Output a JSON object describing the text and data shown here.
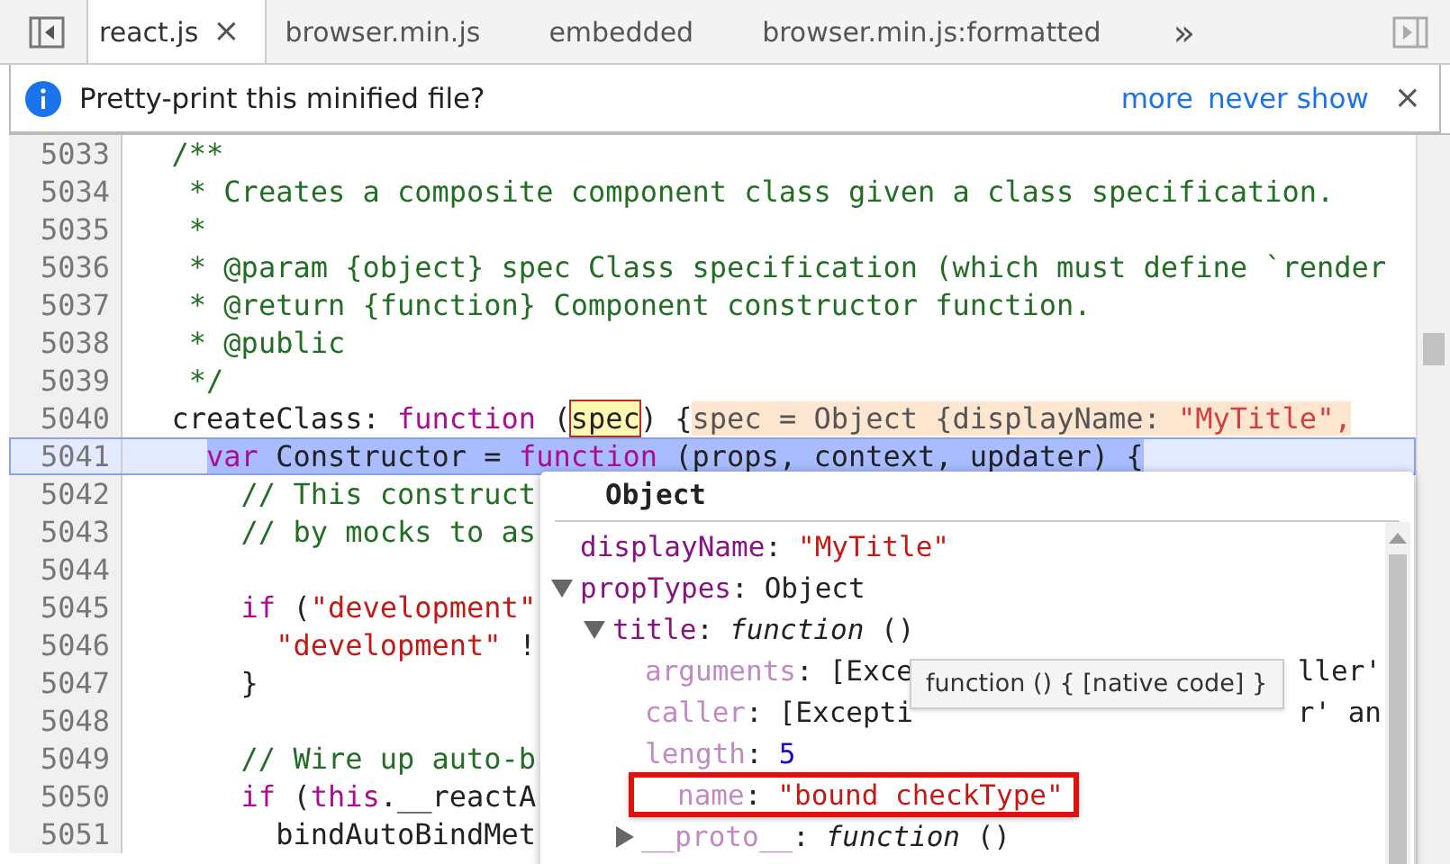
{
  "tabs": [
    {
      "label": "react.js",
      "selected": true,
      "close": "×"
    },
    {
      "label": "browser.min.js",
      "selected": false
    },
    {
      "label": "embedded",
      "selected": false
    },
    {
      "label": "browser.min.js:formatted",
      "selected": false
    }
  ],
  "more_tabs": "»",
  "infobar": {
    "message": "Pretty-print this minified file?",
    "links": [
      "more",
      "never show"
    ],
    "close": "×"
  },
  "lines": [
    {
      "number": "5033",
      "highlighted": false,
      "tokens": [
        {
          "kind": "comment",
          "text": "  /**"
        }
      ]
    },
    {
      "number": "5034",
      "highlighted": false,
      "tokens": [
        {
          "kind": "comment",
          "text": "   * Creates a composite component class given a class specification."
        }
      ]
    },
    {
      "number": "5035",
      "highlighted": false,
      "tokens": [
        {
          "kind": "comment",
          "text": "   *"
        }
      ]
    },
    {
      "number": "5036",
      "highlighted": false,
      "tokens": [
        {
          "kind": "comment",
          "text": "   * @param {object} spec Class specification (which must define `render"
        }
      ]
    },
    {
      "number": "5037",
      "highlighted": false,
      "tokens": [
        {
          "kind": "comment",
          "text": "   * @return {function} Component constructor function."
        }
      ]
    },
    {
      "number": "5038",
      "highlighted": false,
      "tokens": [
        {
          "kind": "comment",
          "text": "   * @public"
        }
      ]
    },
    {
      "number": "5039",
      "highlighted": false,
      "tokens": [
        {
          "kind": "comment",
          "text": "   */"
        }
      ]
    },
    {
      "number": "5040",
      "highlighted": false,
      "tokens": [
        {
          "kind": "plain",
          "text": "  createClass:"
        },
        {
          "kind": "keyword",
          "text": " function"
        },
        {
          "kind": "plain",
          "text": " ("
        },
        {
          "kind": "hovered",
          "text": "spec"
        },
        {
          "kind": "plain",
          "text": ") {"
        },
        {
          "kind": "hint",
          "text": "spec = Object {displayName: "
        },
        {
          "kind": "hint-string",
          "text": "\"MyTitle\","
        }
      ]
    },
    {
      "number": "5041",
      "highlighted": true,
      "tokens": [
        {
          "kind": "keyword",
          "text": "    var"
        },
        {
          "kind": "plain",
          "text": " Constructor = "
        },
        {
          "kind": "keyword",
          "text": "function"
        },
        {
          "kind": "plain",
          "text": " (props, context, updater) {"
        }
      ]
    },
    {
      "number": "5042",
      "highlighted": false,
      "tokens": [
        {
          "kind": "comment",
          "text": "      // This construct"
        }
      ]
    },
    {
      "number": "5043",
      "highlighted": false,
      "tokens": [
        {
          "kind": "comment",
          "text": "      // by mocks to as"
        }
      ]
    },
    {
      "number": "5044",
      "highlighted": false
    },
    {
      "number": "5045",
      "highlighted": false,
      "tokens": [
        {
          "kind": "keyword",
          "text": "      if"
        },
        {
          "kind": "plain",
          "text": " ("
        },
        {
          "kind": "string",
          "text": "\"development\""
        }
      ]
    },
    {
      "number": "5046",
      "highlighted": false,
      "tokens": [
        {
          "kind": "string",
          "text": "        \"development\""
        },
        {
          "kind": "plain",
          "text": " !"
        }
      ]
    },
    {
      "number": "5047",
      "highlighted": false,
      "tokens": [
        {
          "kind": "plain",
          "text": "      }"
        }
      ]
    },
    {
      "number": "5048",
      "highlighted": false
    },
    {
      "number": "5049",
      "highlighted": false,
      "tokens": [
        {
          "kind": "comment",
          "text": "      // Wire up auto-b"
        }
      ]
    },
    {
      "number": "5050",
      "highlighted": false,
      "tokens": [
        {
          "kind": "keyword",
          "text": "      if"
        },
        {
          "kind": "plain",
          "text": " ("
        },
        {
          "kind": "keyword",
          "text": "this"
        },
        {
          "kind": "plain",
          "text": ".__reactA"
        }
      ]
    },
    {
      "number": "5051",
      "highlighted": false,
      "tokens": [
        {
          "kind": "plain",
          "text": "        bindAutoBindMet"
        }
      ]
    }
  ],
  "popover": {
    "title": "Object",
    "tree": [
      {
        "key": "displayName",
        "colon": ":",
        "faded": false,
        "value": "\"MyTitle\"",
        "kind": "string"
      },
      {
        "key": "propTypes",
        "colon": ":",
        "faded": false,
        "value": "Object",
        "kind": "object",
        "expanded": true,
        "children": [
          {
            "key": "title",
            "colon": ":",
            "faded": false,
            "value": "*function* ()",
            "kind": "function",
            "expanded": true,
            "children": [
              {
                "key": "arguments",
                "colon": ":",
                "faded": true,
                "highlighted": false,
                "value": "[Exce",
                "value_end": "ller'",
                "kind": "object"
              },
              {
                "key": "caller",
                "colon": ":",
                "faded": true,
                "highlighted": false,
                "value": "[Excepti",
                "value_end": "r' an",
                "kind": "object"
              },
              {
                "key": "length",
                "colon": ":",
                "faded": true,
                "highlighted": false,
                "value": "5",
                "kind": "number"
              },
              {
                "key": "name",
                "colon": ":",
                "faded": true,
                "highlighted": true,
                "value": "\"bound checkType\"",
                "kind": "string"
              },
              {
                "key": "__proto__",
                "colon": ":",
                "faded": true,
                "highlighted": false,
                "value": "*function* ()",
                "kind": "function",
                "expanded": false
              }
            ]
          }
        ]
      }
    ]
  },
  "tooltip": "function () { [native code] }"
}
